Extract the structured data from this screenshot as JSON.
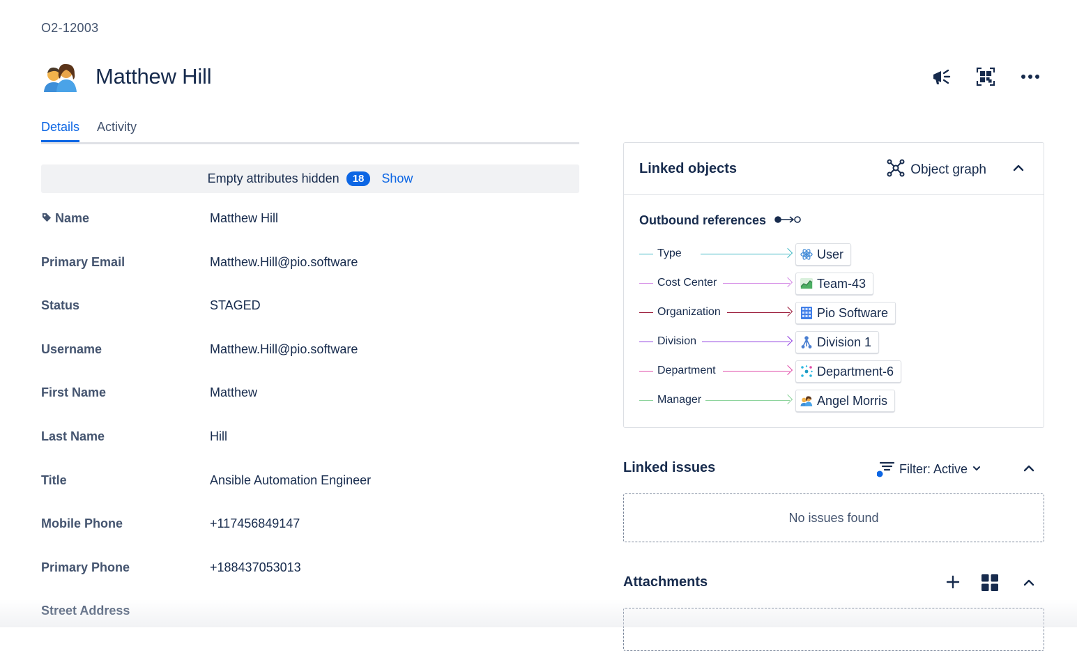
{
  "object_key": "O2-12003",
  "object_name": "Matthew Hill",
  "header_actions": [
    {
      "icon": "megaphone-icon"
    },
    {
      "icon": "qr-code-icon"
    },
    {
      "icon": "more-icon"
    }
  ],
  "tabs": [
    {
      "label": "Details",
      "active": true
    },
    {
      "label": "Activity",
      "active": false
    }
  ],
  "empty_attributes": {
    "text": "Empty attributes hidden",
    "count": "18",
    "show_label": "Show"
  },
  "attributes": [
    {
      "label": "Name",
      "value": "Matthew Hill",
      "icon": "tag-icon"
    },
    {
      "label": "Primary Email",
      "value": "Matthew.Hill@pio.software"
    },
    {
      "label": "Status",
      "value": "STAGED"
    },
    {
      "label": "Username",
      "value": "Matthew.Hill@pio.software"
    },
    {
      "label": "First Name",
      "value": "Matthew"
    },
    {
      "label": "Last Name",
      "value": "Hill"
    },
    {
      "label": "Title",
      "value": "Ansible Automation Engineer"
    },
    {
      "label": "Mobile Phone",
      "value": "+117456849147"
    },
    {
      "label": "Primary Phone",
      "value": "+188437053013"
    },
    {
      "label": "Street Address",
      "value": ""
    }
  ],
  "linked_objects": {
    "title": "Linked objects",
    "graph_label": "Object graph",
    "outbound_title": "Outbound references",
    "references": [
      {
        "label": "Type",
        "target": "User",
        "color": "#3fb8c4",
        "icon": "atom-icon"
      },
      {
        "label": "Cost Center",
        "target": "Team-43",
        "color": "#d58be6",
        "icon": "chart-icon"
      },
      {
        "label": "Organization",
        "target": "Pio Software",
        "color": "#9b1b3a",
        "icon": "building-icon"
      },
      {
        "label": "Division",
        "target": "Division 1",
        "color": "#8f3de0",
        "icon": "hierarchy-icon"
      },
      {
        "label": "Department",
        "target": "Department-6",
        "color": "#e04ba8",
        "icon": "department-icon"
      },
      {
        "label": "Manager",
        "target": "Angel Morris",
        "color": "#8bd39a",
        "icon": "people-icon"
      }
    ]
  },
  "linked_issues": {
    "title": "Linked issues",
    "filter_label": "Filter: Active",
    "empty_text": "No issues found"
  },
  "attachments": {
    "title": "Attachments"
  },
  "colors": {
    "accent": "#0c66e4",
    "text": "#172b4d",
    "subtle": "#44546f",
    "border": "#dcdfe4"
  }
}
